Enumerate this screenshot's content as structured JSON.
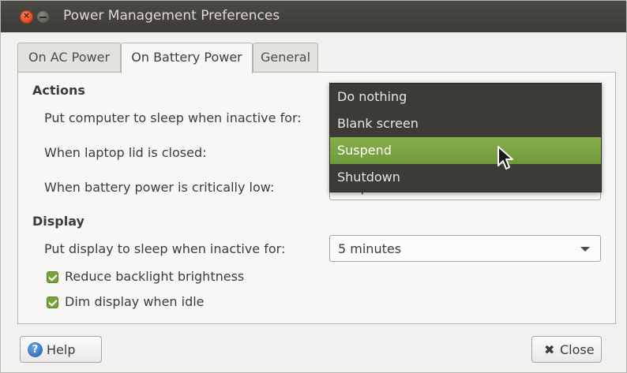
{
  "window": {
    "title": "Power Management Preferences"
  },
  "tabs": [
    {
      "label": "On AC Power",
      "active": false
    },
    {
      "label": "On Battery Power",
      "active": true
    },
    {
      "label": "General",
      "active": false
    }
  ],
  "actions": {
    "heading": "Actions",
    "sleep_label": "Put computer to sleep when inactive for:",
    "lid_label": "When laptop lid is closed:",
    "critical_label": "When battery power is critically low:",
    "critical_value": "Suspend"
  },
  "dropdown": {
    "options": [
      "Do nothing",
      "Blank screen",
      "Suspend",
      "Shutdown"
    ],
    "highlighted": "Suspend",
    "highlight_color": "#7aa440"
  },
  "display": {
    "heading": "Display",
    "sleep_label": "Put display to sleep when inactive for:",
    "sleep_value": "5 minutes",
    "reduce_backlight_label": "Reduce backlight brightness",
    "reduce_backlight_checked": true,
    "dim_label": "Dim display when idle",
    "dim_checked": true
  },
  "buttons": {
    "help_label": "Help",
    "close_label": "Close"
  },
  "icons": {
    "close_window": "close-icon",
    "minimize_window": "minimize-icon",
    "help": "help-icon",
    "close_button": "x-icon",
    "dropdown_arrow": "chevron-down-icon",
    "cursor": "mouse-pointer-icon"
  }
}
